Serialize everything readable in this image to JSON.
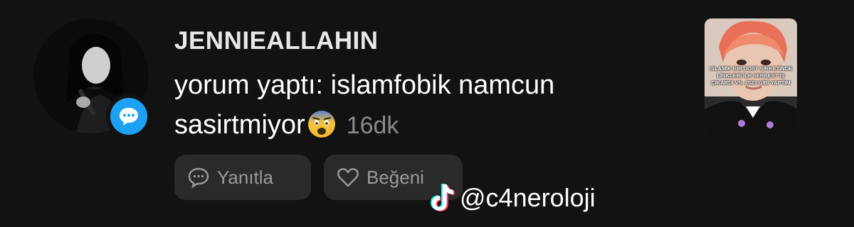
{
  "comment": {
    "username": "JENNIEALLAHIN",
    "text_line1": "yorum yaptı: islamfobik namcun",
    "text_line2": "sasirtmiyor",
    "emoji": "fearful-face-emoji",
    "time": "16dk"
  },
  "badge": {
    "icon": "chat-bubble-icon",
    "color": "#1da1f2"
  },
  "actions": {
    "reply_label": "Yanıtla",
    "like_label": "Beğeni"
  },
  "thumbnail": {
    "caption": "ISLAMIK BIR DOST ŞİRKETİNDE LİNKLERİ İLE SERBEST İŞ ÇIKARDI VS. 2023 GİBİ YAPTIM"
  },
  "watermark": {
    "icon": "tiktok-logo-icon",
    "handle": "@c4neroloji"
  }
}
